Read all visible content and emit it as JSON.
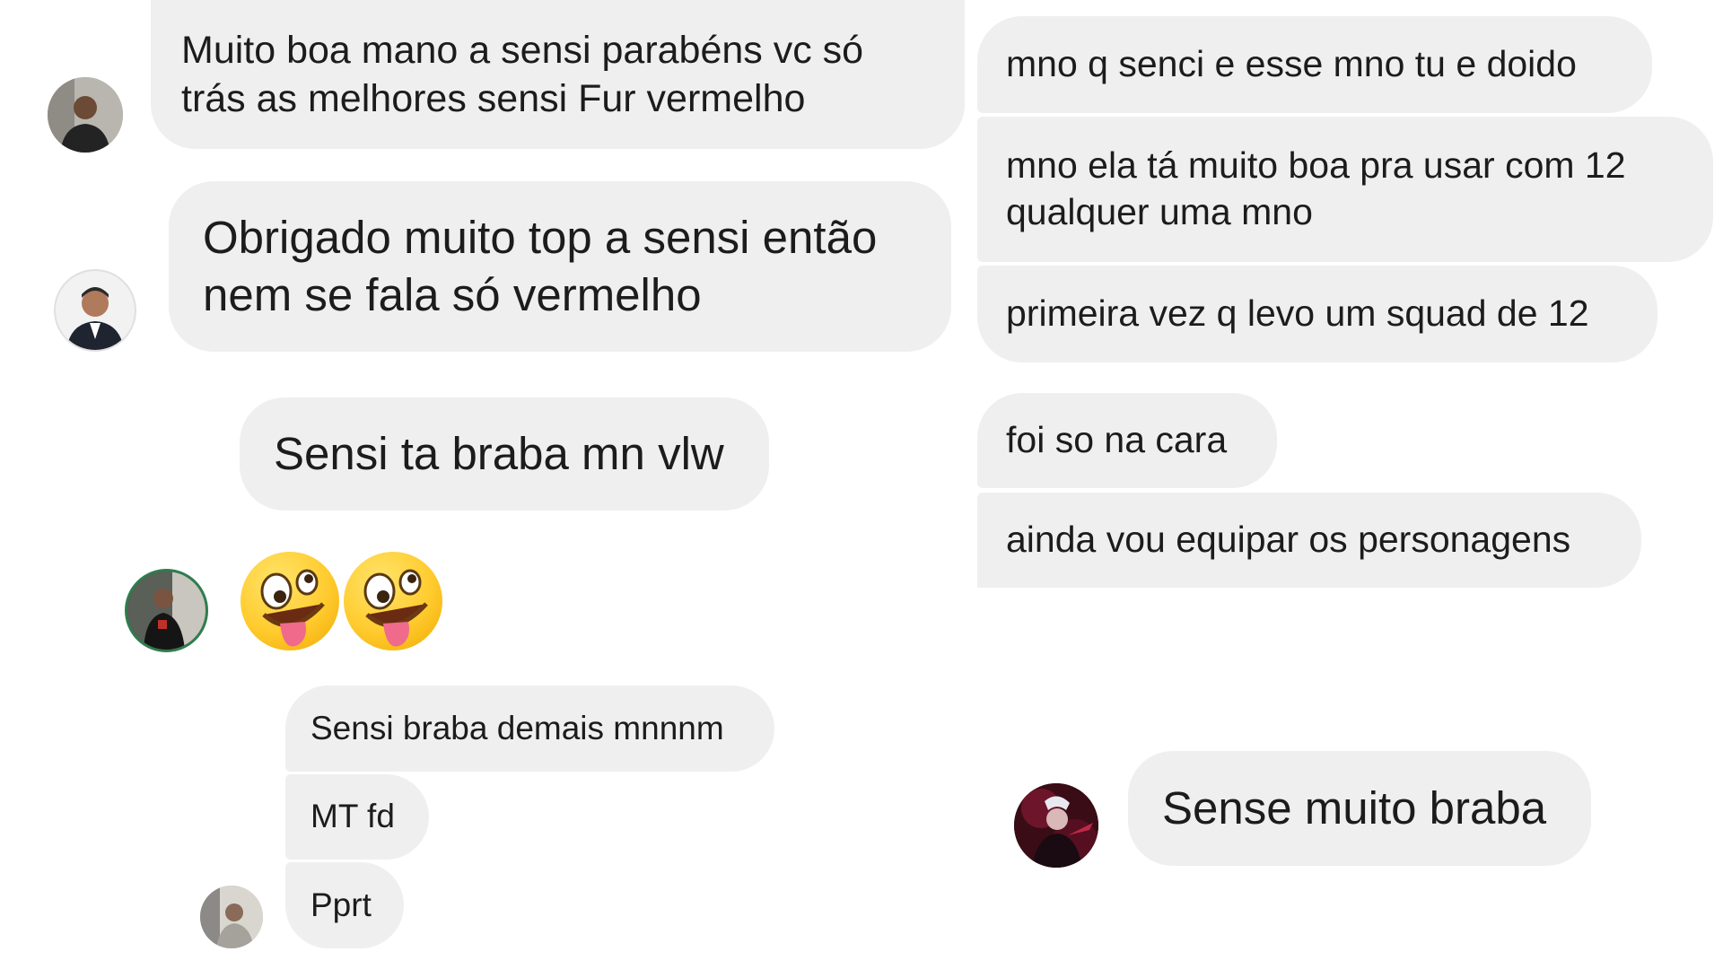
{
  "left_column": {
    "messages": [
      {
        "text": "Muito boa mano a sensi parabéns vc só trás as melhores sensi Fur vermelho"
      },
      {
        "text": "Obrigado muito top a sensi então nem se fala só vermelho"
      },
      {
        "text": "Sensi ta braba mn vlw"
      },
      {
        "text": "Sensi braba demais mnnnm"
      },
      {
        "text": "MT fd"
      },
      {
        "text": "Pprt"
      }
    ],
    "emoji_reaction": {
      "icon": "zany-face-emoji",
      "count": 2
    }
  },
  "right_column": {
    "messages": [
      {
        "text": "mno q senci e esse mno tu e doido"
      },
      {
        "text": "mno ela tá muito boa pra usar com 12 qualquer uma mno"
      },
      {
        "text": "primeira vez q levo um squad de 12"
      },
      {
        "text": "foi so na cara"
      },
      {
        "text": "ainda vou equipar os personagens"
      },
      {
        "text": "Sense muito braba"
      }
    ]
  },
  "colors": {
    "background": "#ffffff",
    "bubble": "#efefef",
    "text": "#1c1c1c"
  }
}
